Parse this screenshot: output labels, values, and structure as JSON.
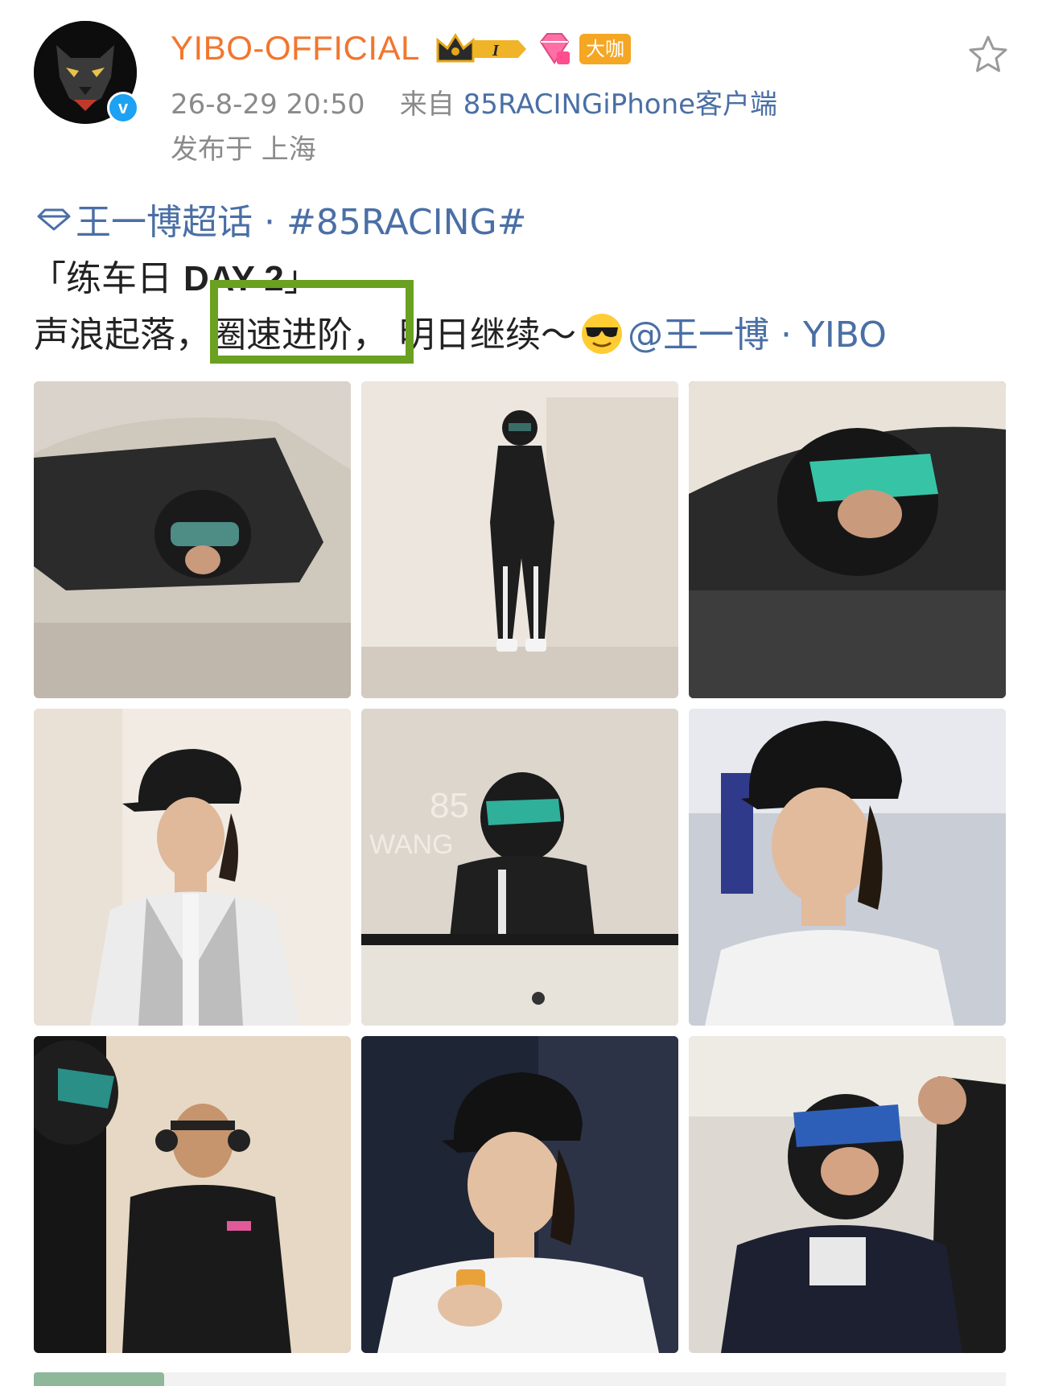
{
  "header": {
    "username": "YIBO-OFFICIAL",
    "vip_badge": "大咖",
    "timestamp": "26-8-29 20:50",
    "source_prefix": "来自",
    "source": "85RACINGiPhone客户端",
    "location": "发布于 上海"
  },
  "post": {
    "topic": "王一博超话 · #85RACING#",
    "line1_prefix": "「练车日 ",
    "line1_bold": "DAY 2",
    "line1_suffix": "」",
    "line2_part1": "声浪起落，",
    "line2_highlight": "圈速进阶，",
    "line2_part2": " 明日继续～",
    "line2_mention": "@王一博 · YIBO"
  },
  "photos": [
    {
      "subject": "driver in car, side view"
    },
    {
      "subject": "driver standing in racing suit"
    },
    {
      "subject": "driver in helmet inside car"
    },
    {
      "subject": "portrait with black cap"
    },
    {
      "subject": "driver in helmet by wall"
    },
    {
      "subject": "portrait close-up with cap"
    },
    {
      "subject": "team member with headset"
    },
    {
      "subject": "portrait holding drink"
    },
    {
      "subject": "driver in helmet with crew"
    }
  ],
  "colors": {
    "username": "#f2762e",
    "link": "#4a6fa5",
    "highlight": "#6aa120",
    "meta": "#8a8a8a"
  },
  "icons": {
    "star": "star-outline-icon",
    "topic": "diamond-icon",
    "verified": "verified-check-icon"
  }
}
